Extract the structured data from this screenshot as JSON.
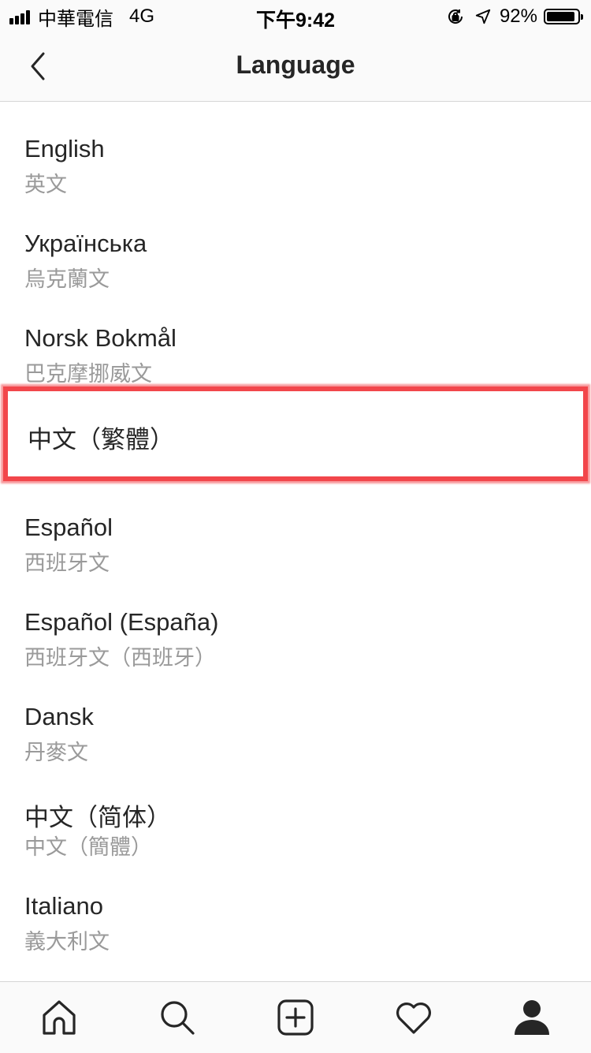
{
  "status_bar": {
    "carrier": "中華電信",
    "network": "4G",
    "time": "下午9:42",
    "battery": "92%",
    "battery_level": 0.92,
    "icons": [
      "signal-icon",
      "orientation-lock-icon",
      "location-icon",
      "battery-icon"
    ]
  },
  "nav": {
    "back_icon": "chevron-left-icon",
    "title": "Language"
  },
  "languages": [
    {
      "name": "English",
      "native": "英文"
    },
    {
      "name": "Українська",
      "native": "烏克蘭文"
    },
    {
      "name": "Norsk Bokmål",
      "native": "巴克摩挪威文"
    },
    {
      "name": "中文（繁體）",
      "native": ""
    },
    {
      "name": "Español",
      "native": "西班牙文"
    },
    {
      "name": "Español (España)",
      "native": "西班牙文（西班牙）"
    },
    {
      "name": "Dansk",
      "native": "丹麥文"
    },
    {
      "name": "中文（简体）",
      "native": "中文（簡體）"
    },
    {
      "name": "Italiano",
      "native": "義大利文"
    }
  ],
  "highlight_color": "#f2464b",
  "tab_bar": {
    "tabs": [
      "home-icon",
      "search-icon",
      "add-post-icon",
      "heart-icon",
      "profile-icon"
    ]
  }
}
